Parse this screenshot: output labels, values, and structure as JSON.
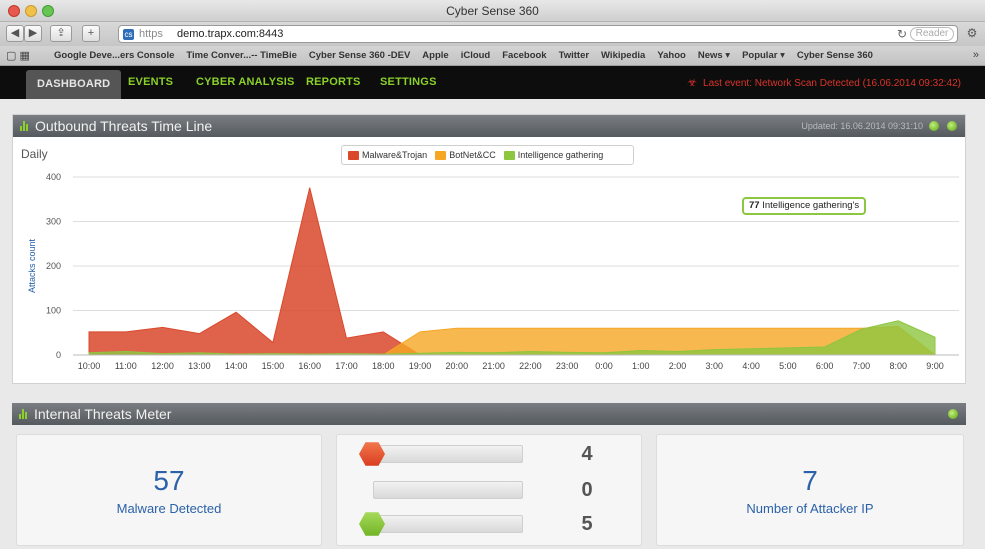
{
  "browser": {
    "window_title": "Cyber Sense 360",
    "url_scheme": "https",
    "url_host": "demo.trapx.com:8443",
    "reader_label": "Reader",
    "bookmarks": [
      "Google Deve...ers Console",
      "Time Conver...-- TimeBie",
      "Cyber Sense 360 -DEV",
      "Apple",
      "iCloud",
      "Facebook",
      "Twitter",
      "Wikipedia",
      "Yahoo",
      "News ▾",
      "Popular ▾",
      "Cyber Sense 360"
    ]
  },
  "nav": {
    "tabs": [
      "DASHBOARD",
      "EVENTS",
      "CYBER ANALYSIS",
      "REPORTS",
      "SETTINGS"
    ],
    "active_tab": "DASHBOARD",
    "last_event": "Last event: Network Scan Detected (16.06.2014 09:32:42)"
  },
  "timeline_panel": {
    "title": "Outbound Threats Time Line",
    "updated": "Updated: 16.06.2014 09:31:10",
    "period_label": "Daily",
    "tooltip_value": "77",
    "tooltip_label": "Intelligence gathering's"
  },
  "colors": {
    "malware": "#d9482b",
    "botnet": "#f5a623",
    "intel": "#8dc63f",
    "accent_green": "#8ad12a",
    "brand_blue": "#2a61a8"
  },
  "chart_data": {
    "type": "area",
    "ylabel": "Attacks count",
    "xlabel": "",
    "ylim": [
      0,
      400
    ],
    "yticks": [
      0,
      100,
      200,
      300,
      400
    ],
    "categories": [
      "10:00",
      "11:00",
      "12:00",
      "13:00",
      "14:00",
      "15:00",
      "16:00",
      "17:00",
      "18:00",
      "19:00",
      "20:00",
      "21:00",
      "22:00",
      "23:00",
      "0:00",
      "1:00",
      "2:00",
      "3:00",
      "4:00",
      "5:00",
      "6:00",
      "7:00",
      "8:00",
      "9:00"
    ],
    "series": [
      {
        "name": "Malware&Trojan",
        "color": "#d9482b",
        "values": [
          52,
          52,
          62,
          48,
          96,
          28,
          376,
          38,
          52,
          0,
          0,
          0,
          0,
          0,
          0,
          0,
          0,
          0,
          0,
          0,
          0,
          0,
          0,
          0
        ]
      },
      {
        "name": "BotNet&CC",
        "color": "#f5a623",
        "values": [
          0,
          0,
          0,
          0,
          0,
          0,
          0,
          0,
          0,
          52,
          60,
          60,
          60,
          60,
          60,
          60,
          60,
          60,
          60,
          60,
          60,
          60,
          64,
          0
        ]
      },
      {
        "name": "Intelligence gathering",
        "color": "#8dc63f",
        "values": [
          5,
          8,
          3,
          5,
          2,
          3,
          2,
          3,
          2,
          4,
          6,
          5,
          8,
          6,
          5,
          10,
          8,
          12,
          14,
          16,
          18,
          58,
          77,
          40
        ]
      }
    ],
    "legend_position": "top-center",
    "grid": true
  },
  "meter_panel": {
    "title": "Internal Threats Meter",
    "malware_count": "57",
    "malware_label": "Malware Detected",
    "levels": [
      {
        "value": "4",
        "color": "#e5492b"
      },
      {
        "value": "0",
        "color": "#c9c9c9"
      },
      {
        "value": "5",
        "color": "#8dc63f"
      }
    ],
    "attacker_count": "7",
    "attacker_label": "Number of Attacker IP"
  }
}
